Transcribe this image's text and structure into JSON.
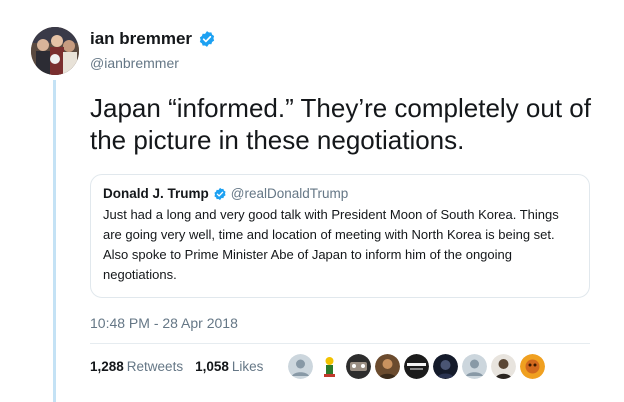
{
  "author": {
    "display_name": "ian bremmer",
    "handle": "@ianbremmer",
    "avatar_icon": "group-photo-avatar"
  },
  "tweet": {
    "text": "Japan “informed.” They’re completely out of the picture in these negotiations."
  },
  "quoted": {
    "display_name": "Donald J. Trump",
    "handle": "@realDonaldTrump",
    "text": "Just had a long and very good talk with President Moon of South Korea. Things are going very well, time and location of meeting with North Korea is being set. Also spoke to Prime Minister Abe of Japan to inform him of the ongoing negotiations."
  },
  "timestamp": "10:48 PM - 28 Apr 2018",
  "stats": {
    "retweets_count": "1,288",
    "retweets_label": "Retweets",
    "likes_count": "1,058",
    "likes_label": "Likes"
  },
  "colors": {
    "verified": "#1da1f2",
    "thread_line": "#c4e2f5",
    "secondary_text": "#657786"
  }
}
